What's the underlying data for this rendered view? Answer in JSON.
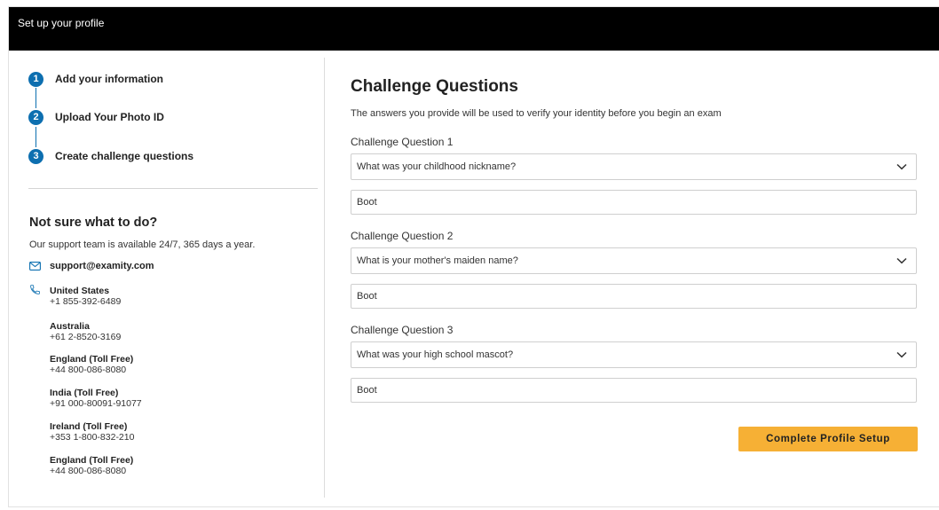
{
  "window": {
    "title": "Set up your profile"
  },
  "steps": [
    {
      "number": "1",
      "label": "Add your information"
    },
    {
      "number": "2",
      "label": "Upload Your Photo ID"
    },
    {
      "number": "3",
      "label": "Create challenge questions"
    }
  ],
  "help": {
    "title": "Not sure what to do?",
    "text": "Our support team is available 24/7, 365 days a year.",
    "email": "support@examity.com",
    "email_icon": "mail-icon",
    "phone_icon": "phone-icon",
    "phones": [
      {
        "country": "United States",
        "number": "+1 855-392-6489"
      },
      {
        "country": "Australia",
        "number": "+61 2-8520-3169"
      },
      {
        "country": "England (Toll Free)",
        "number": "+44 800-086-8080"
      },
      {
        "country": "India (Toll Free)",
        "number": "+91 000-80091-91077"
      },
      {
        "country": "Ireland (Toll Free)",
        "number": "+353 1-800-832-210"
      },
      {
        "country": "England (Toll Free)",
        "number": "+44 800-086-8080"
      }
    ]
  },
  "main": {
    "title": "Challenge Questions",
    "subtitle": "The answers you provide will be used to verify your identity before you begin an exam",
    "questions": [
      {
        "label": "Challenge Question 1",
        "selected": "What was your childhood nickname?",
        "answer": "Boot"
      },
      {
        "label": "Challenge Question 2",
        "selected": "What is your mother's maiden name?",
        "answer": "Boot"
      },
      {
        "label": "Challenge Question 3",
        "selected": "What was your high school mascot?",
        "answer": "Boot"
      }
    ],
    "submit_label": "Complete Profile Setup"
  },
  "colors": {
    "titlebar": "#000000",
    "step_accent": "#0d6fb0",
    "button": "#f6b035"
  }
}
